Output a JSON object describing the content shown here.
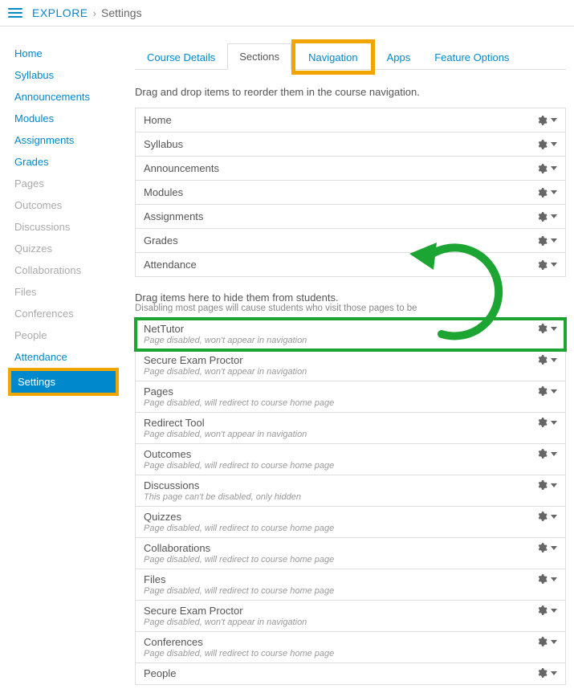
{
  "breadcrumb": {
    "root": "EXPLORE",
    "sep": "›",
    "current": "Settings"
  },
  "sidebar": {
    "items": [
      {
        "label": "Home",
        "disabled": false
      },
      {
        "label": "Syllabus",
        "disabled": false
      },
      {
        "label": "Announcements",
        "disabled": false
      },
      {
        "label": "Modules",
        "disabled": false
      },
      {
        "label": "Assignments",
        "disabled": false
      },
      {
        "label": "Grades",
        "disabled": false
      },
      {
        "label": "Pages",
        "disabled": true
      },
      {
        "label": "Outcomes",
        "disabled": true
      },
      {
        "label": "Discussions",
        "disabled": true
      },
      {
        "label": "Quizzes",
        "disabled": true
      },
      {
        "label": "Collaborations",
        "disabled": true
      },
      {
        "label": "Files",
        "disabled": true
      },
      {
        "label": "Conferences",
        "disabled": true
      },
      {
        "label": "People",
        "disabled": true
      },
      {
        "label": "Attendance",
        "disabled": false
      },
      {
        "label": "Settings",
        "disabled": false,
        "active": true
      }
    ]
  },
  "tabs": {
    "items": [
      {
        "label": "Course Details"
      },
      {
        "label": "Sections",
        "active": true
      },
      {
        "label": "Navigation",
        "highlight": true
      },
      {
        "label": "Apps"
      },
      {
        "label": "Feature Options"
      }
    ]
  },
  "instruction": "Drag and drop items to reorder them in the course navigation.",
  "visibleNav": [
    {
      "label": "Home"
    },
    {
      "label": "Syllabus"
    },
    {
      "label": "Announcements"
    },
    {
      "label": "Modules"
    },
    {
      "label": "Assignments"
    },
    {
      "label": "Grades"
    },
    {
      "label": "Attendance"
    }
  ],
  "hideIntro": "Drag items here to hide them from students.",
  "hideSub": "Disabling most pages will cause students who visit those pages to be",
  "hiddenNav": [
    {
      "label": "NetTutor",
      "sub": "Page disabled, won't appear in navigation",
      "highlight": true
    },
    {
      "label": "Secure Exam Proctor",
      "sub": "Page disabled, won't appear in navigation"
    },
    {
      "label": "Pages",
      "sub": "Page disabled, will redirect to course home page"
    },
    {
      "label": "Redirect Tool",
      "sub": "Page disabled, won't appear in navigation"
    },
    {
      "label": "Outcomes",
      "sub": "Page disabled, will redirect to course home page"
    },
    {
      "label": "Discussions",
      "sub": "This page can't be disabled, only hidden"
    },
    {
      "label": "Quizzes",
      "sub": "Page disabled, will redirect to course home page"
    },
    {
      "label": "Collaborations",
      "sub": "Page disabled, will redirect to course home page"
    },
    {
      "label": "Files",
      "sub": "Page disabled, will redirect to course home page"
    },
    {
      "label": "Secure Exam Proctor",
      "sub": "Page disabled, won't appear in navigation"
    },
    {
      "label": "Conferences",
      "sub": "Page disabled, will redirect to course home page"
    },
    {
      "label": "People",
      "sub": ""
    }
  ]
}
